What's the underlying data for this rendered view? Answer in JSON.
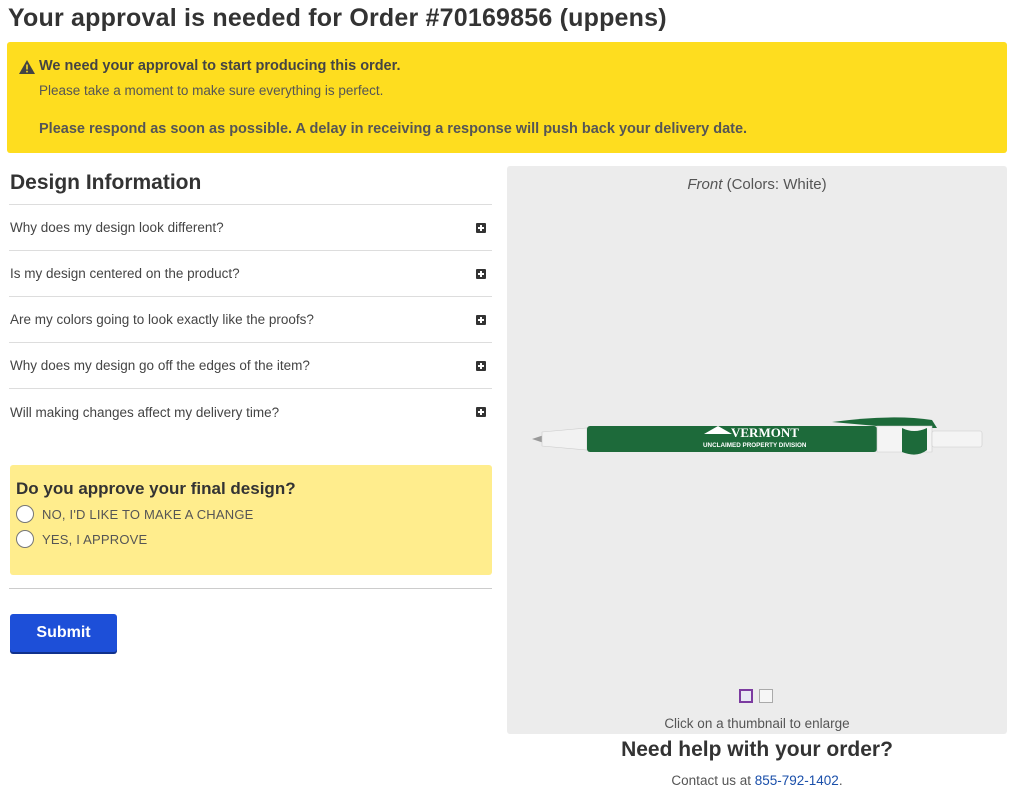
{
  "page": {
    "title": "Your approval is needed for Order #70169856 (uppens)"
  },
  "alert": {
    "icon": "warning-icon",
    "headline": "We need your approval to start producing this order.",
    "subtext": "Please take a moment to make sure everything is perfect.",
    "urgent": "Please respond as soon as possible. A delay in receiving a response will push back your delivery date.",
    "bg_color": "#fedd1f"
  },
  "design_info": {
    "title": "Design Information",
    "faqs": [
      {
        "question": "Why does my design look different?"
      },
      {
        "question": "Is my design centered on the product?"
      },
      {
        "question": "Are my colors going to look exactly like the proofs?"
      },
      {
        "question": "Why does my design go off the edges of the item?"
      },
      {
        "question": "Will making changes affect my delivery time?"
      }
    ]
  },
  "approval": {
    "question": "Do you approve your final design?",
    "options": [
      {
        "label": "NO, I'D LIKE TO MAKE A CHANGE",
        "selected": false
      },
      {
        "label": "YES, I APPROVE",
        "selected": false
      }
    ],
    "bg_color": "#ffed8d"
  },
  "submit": {
    "label": "Submit",
    "color": "#1d4fd8"
  },
  "preview": {
    "side": "Front",
    "colors": "(Colors: White)",
    "hint": "Click on a thumbnail to enlarge",
    "pen_brand": "VERMONT",
    "pen_subtitle": "UNCLAIMED PROPERTY DIVISION",
    "pen_color": "#1d6a3a"
  },
  "help": {
    "title": "Need help with your order?",
    "contact_prefix": "Contact us at",
    "phone": "855-792-1402",
    "contact_suffix": "."
  }
}
